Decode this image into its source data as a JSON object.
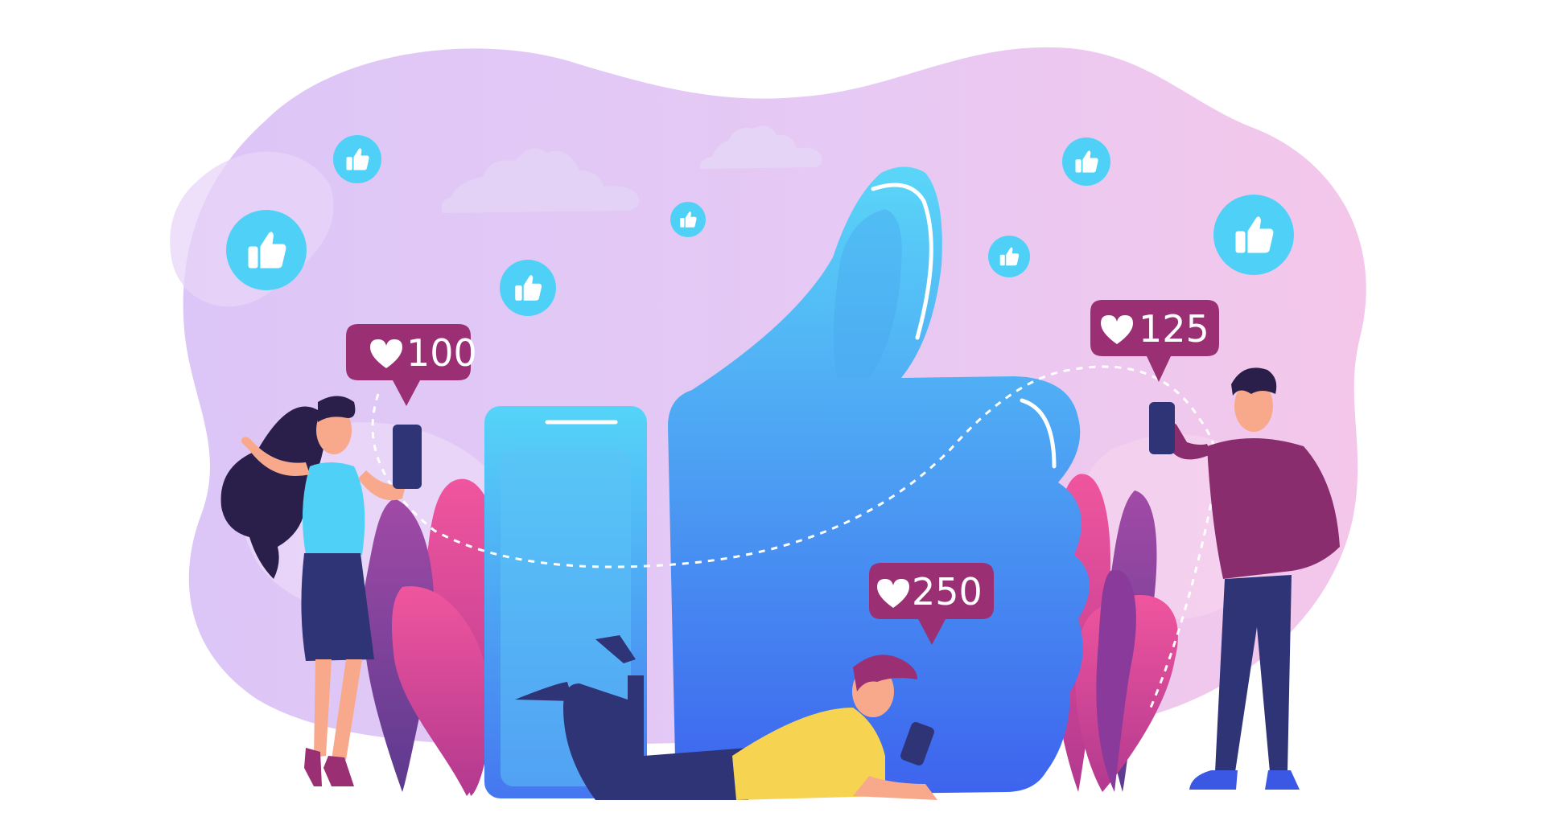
{
  "colors": {
    "background": "#ffffff",
    "blob": "#e7c9f5",
    "blob_pink": "#f2c4ec",
    "like_circle": "#4fd1f7",
    "thumb_light": "#5ad3f7",
    "thumb_dark": "#3b6cf0",
    "badge": "#9b2f73",
    "navy": "#2f3477",
    "skin": "#f8a98c"
  },
  "icons": [
    "thumbs-up-icon",
    "heart-icon"
  ],
  "like_badges": [
    {
      "id": "badge-left",
      "count": "100"
    },
    {
      "id": "badge-right",
      "count": "125"
    },
    {
      "id": "badge-center",
      "count": "250"
    }
  ]
}
